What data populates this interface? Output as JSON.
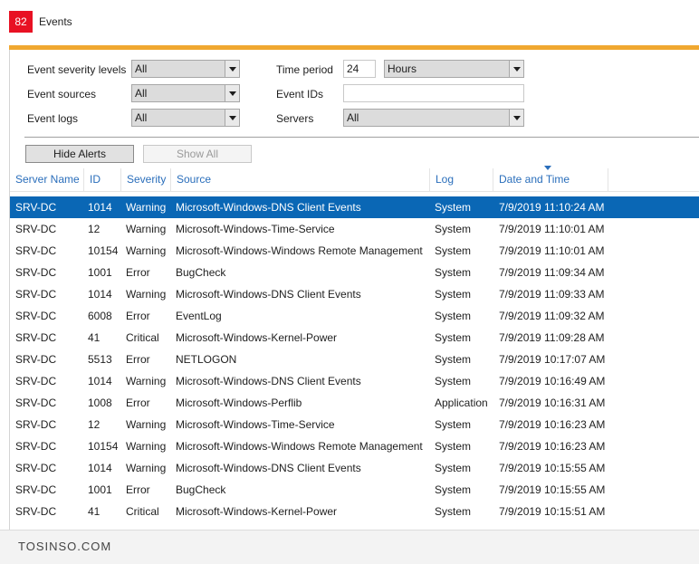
{
  "header": {
    "count": "82",
    "title": "Events"
  },
  "filters": {
    "severity_label": "Event severity levels",
    "severity_value": "All",
    "sources_label": "Event sources",
    "sources_value": "All",
    "logs_label": "Event logs",
    "logs_value": "All",
    "time_period_label": "Time period",
    "time_period_value": "24",
    "time_unit_value": "Hours",
    "event_ids_label": "Event IDs",
    "event_ids_value": "",
    "servers_label": "Servers",
    "servers_value": "All"
  },
  "buttons": {
    "hide_alerts": "Hide Alerts",
    "show_all": "Show All"
  },
  "columns": [
    "Server Name",
    "ID",
    "Severity",
    "Source",
    "Log",
    "Date and Time"
  ],
  "rows": [
    [
      "SRV-DC",
      "1014",
      "Warning",
      "Microsoft-Windows-DNS Client Events",
      "System",
      "7/9/2019 11:10:24 AM"
    ],
    [
      "SRV-DC",
      "12",
      "Warning",
      "Microsoft-Windows-Time-Service",
      "System",
      "7/9/2019 11:10:01 AM"
    ],
    [
      "SRV-DC",
      "10154",
      "Warning",
      "Microsoft-Windows-Windows Remote Management",
      "System",
      "7/9/2019 11:10:01 AM"
    ],
    [
      "SRV-DC",
      "1001",
      "Error",
      "BugCheck",
      "System",
      "7/9/2019 11:09:34 AM"
    ],
    [
      "SRV-DC",
      "1014",
      "Warning",
      "Microsoft-Windows-DNS Client Events",
      "System",
      "7/9/2019 11:09:33 AM"
    ],
    [
      "SRV-DC",
      "6008",
      "Error",
      "EventLog",
      "System",
      "7/9/2019 11:09:32 AM"
    ],
    [
      "SRV-DC",
      "41",
      "Critical",
      "Microsoft-Windows-Kernel-Power",
      "System",
      "7/9/2019 11:09:28 AM"
    ],
    [
      "SRV-DC",
      "5513",
      "Error",
      "NETLOGON",
      "System",
      "7/9/2019 10:17:07 AM"
    ],
    [
      "SRV-DC",
      "1014",
      "Warning",
      "Microsoft-Windows-DNS Client Events",
      "System",
      "7/9/2019 10:16:49 AM"
    ],
    [
      "SRV-DC",
      "1008",
      "Error",
      "Microsoft-Windows-Perflib",
      "Application",
      "7/9/2019 10:16:31 AM"
    ],
    [
      "SRV-DC",
      "12",
      "Warning",
      "Microsoft-Windows-Time-Service",
      "System",
      "7/9/2019 10:16:23 AM"
    ],
    [
      "SRV-DC",
      "10154",
      "Warning",
      "Microsoft-Windows-Windows Remote Management",
      "System",
      "7/9/2019 10:16:23 AM"
    ],
    [
      "SRV-DC",
      "1014",
      "Warning",
      "Microsoft-Windows-DNS Client Events",
      "System",
      "7/9/2019 10:15:55 AM"
    ],
    [
      "SRV-DC",
      "1001",
      "Error",
      "BugCheck",
      "System",
      "7/9/2019 10:15:55 AM"
    ],
    [
      "SRV-DC",
      "41",
      "Critical",
      "Microsoft-Windows-Kernel-Power",
      "System",
      "7/9/2019 10:15:51 AM"
    ]
  ],
  "selected_row": 0,
  "watermark": "TOSINSO.COM",
  "colors": {
    "badge": "#e81123",
    "accent_bar": "#f0a830",
    "selection": "#0a67b5",
    "header_text": "#2a6ebb"
  }
}
